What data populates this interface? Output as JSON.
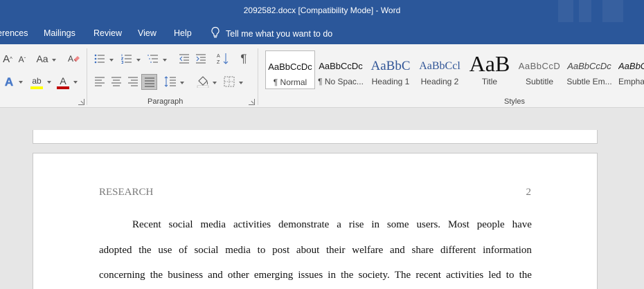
{
  "window": {
    "title": "2092582.docx [Compatibility Mode]  -  Word"
  },
  "menu": {
    "items": [
      "erences",
      "Mailings",
      "Review",
      "View",
      "Help"
    ],
    "tell_me": "Tell me what you want to do"
  },
  "ribbon": {
    "font_group": {
      "grow_label": "A",
      "shrink_label": "A",
      "case_label": "Aa",
      "text_effects_label": "A",
      "highlight_label": "ab",
      "font_color_label": "A"
    },
    "paragraph_group": {
      "label": "Paragraph"
    },
    "styles_group": {
      "label": "Styles",
      "items": [
        {
          "sample": "AaBbCcDc",
          "name": "¶ Normal"
        },
        {
          "sample": "AaBbCcDc",
          "name": "¶ No Spac..."
        },
        {
          "sample": "AaBbC",
          "name": "Heading 1"
        },
        {
          "sample": "AaBbCcl",
          "name": "Heading 2"
        },
        {
          "sample": "AaB",
          "name": "Title"
        },
        {
          "sample": "AaBbCcD",
          "name": "Subtitle"
        },
        {
          "sample": "AaBbCcDc",
          "name": "Subtle Em..."
        },
        {
          "sample": "AaBbC",
          "name": "Empha"
        }
      ]
    }
  },
  "document": {
    "running_head": "RESEARCH",
    "page_number": "2",
    "lines": [
      [
        "Recent",
        "social",
        "media",
        "activities",
        "demonstrate",
        "a",
        "rise",
        "in",
        "some",
        "users.",
        "Most",
        "people",
        "have"
      ],
      [
        "adopted",
        "the",
        "use",
        "of",
        "social",
        "media",
        "to",
        "post",
        "about",
        "their",
        "welfare",
        "and",
        "share",
        "different",
        "information"
      ],
      [
        "concerning",
        "the",
        "business",
        "and",
        "other",
        "emerging",
        "issues",
        "in",
        "the",
        "society.",
        "The",
        "recent",
        "activities",
        "led",
        "to",
        "the"
      ]
    ]
  },
  "colors": {
    "word_blue": "#2b579a",
    "ribbon_bg": "#f3f3f3",
    "canvas_bg": "#e6e6e6",
    "highlight_yellow": "#ffff00",
    "font_red": "#c00000"
  }
}
